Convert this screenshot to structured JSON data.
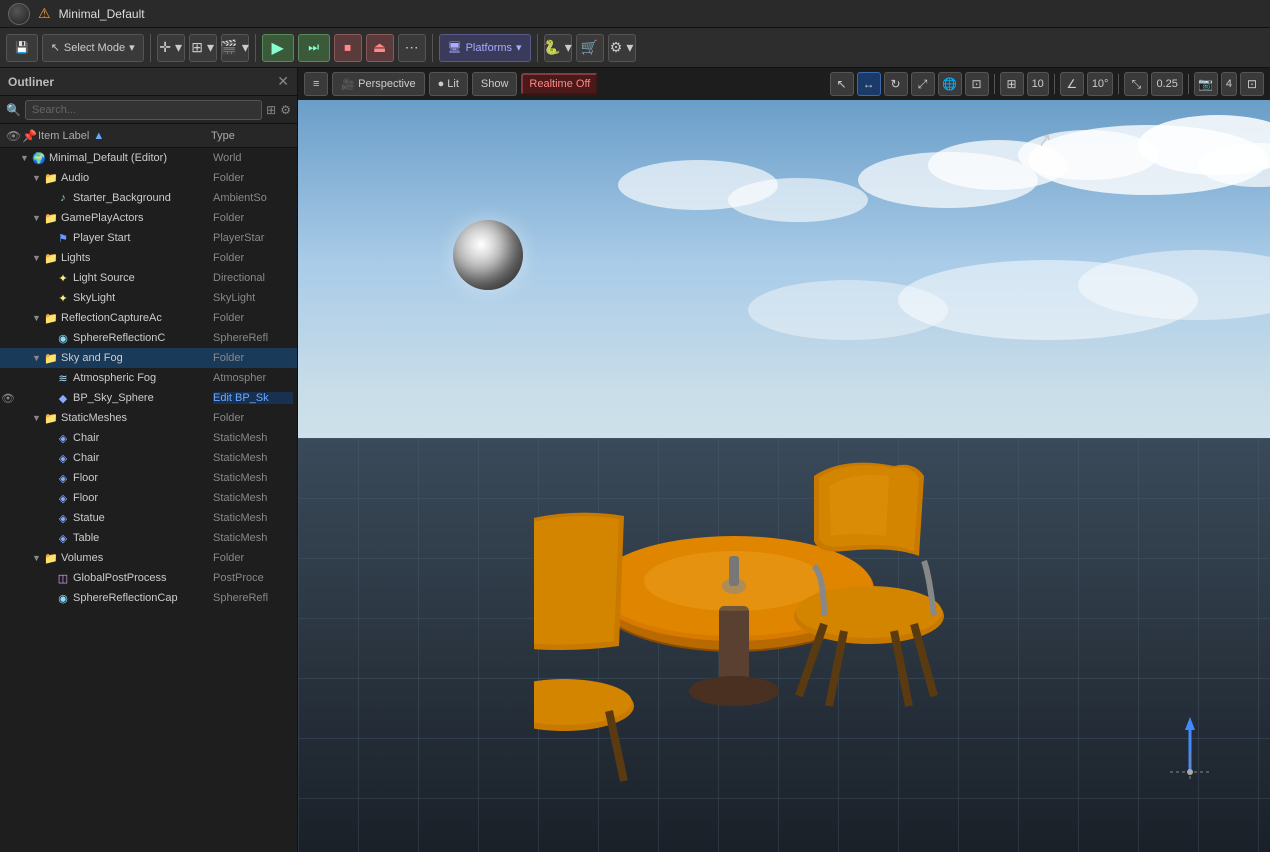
{
  "titleBar": {
    "title": "Minimal_Default",
    "warning": "⚠"
  },
  "toolbar": {
    "selectMode": "Select Mode",
    "platforms": "Platforms",
    "saveLabel": "💾",
    "addLabel": "＋",
    "blueprintLabel": "🔷",
    "cinematicLabel": "🎬",
    "playLabel": "▶",
    "pauseLabel": "⏸",
    "stopLabel": "⏹",
    "ejectLabel": "⏏",
    "moreLabel": "⋯",
    "greenBpLabel": "🐍",
    "settingsLabel": "⚙"
  },
  "outliner": {
    "title": "Outliner",
    "searchPlaceholder": "Search...",
    "colLabel": "Item Label",
    "colType": "Type",
    "items": [
      {
        "label": "Minimal_Default (Editor)",
        "type": "World",
        "indent": 0,
        "expanded": true,
        "icon": "world",
        "eye": false
      },
      {
        "label": "Audio",
        "type": "Folder",
        "indent": 1,
        "expanded": true,
        "icon": "folder",
        "eye": false
      },
      {
        "label": "Starter_Background",
        "type": "AmbientSo",
        "indent": 2,
        "expanded": false,
        "icon": "ambient",
        "eye": false
      },
      {
        "label": "GamePlayActors",
        "type": "Folder",
        "indent": 1,
        "expanded": true,
        "icon": "folder",
        "eye": false
      },
      {
        "label": "Player Start",
        "type": "PlayerStar",
        "indent": 2,
        "expanded": false,
        "icon": "actor",
        "eye": false
      },
      {
        "label": "Lights",
        "type": "Folder",
        "indent": 1,
        "expanded": true,
        "icon": "folder",
        "eye": false
      },
      {
        "label": "Light Source",
        "type": "Directional",
        "indent": 2,
        "expanded": false,
        "icon": "light",
        "eye": false
      },
      {
        "label": "SkyLight",
        "type": "SkyLight",
        "indent": 2,
        "expanded": false,
        "icon": "light",
        "eye": false
      },
      {
        "label": "ReflectionCaptureAc",
        "type": "Folder",
        "indent": 1,
        "expanded": true,
        "icon": "folder",
        "eye": false
      },
      {
        "label": "SphereReflectionC",
        "type": "SphereRefl",
        "indent": 2,
        "expanded": false,
        "icon": "capture",
        "eye": false
      },
      {
        "label": "Sky and Fog",
        "type": "Folder",
        "indent": 1,
        "expanded": true,
        "icon": "folder",
        "eye": false,
        "selected": true
      },
      {
        "label": "Atmospheric Fog",
        "type": "Atmospher",
        "indent": 2,
        "expanded": false,
        "icon": "fog",
        "eye": false
      },
      {
        "label": "BP_Sky_Sphere",
        "type": "Edit BP_Sk",
        "indent": 2,
        "expanded": false,
        "icon": "bp",
        "eye": true,
        "editing": true
      },
      {
        "label": "StaticMeshes",
        "type": "Folder",
        "indent": 1,
        "expanded": true,
        "icon": "folder",
        "eye": false
      },
      {
        "label": "Chair",
        "type": "StaticMesh",
        "indent": 2,
        "expanded": false,
        "icon": "mesh",
        "eye": false
      },
      {
        "label": "Chair",
        "type": "StaticMesh",
        "indent": 2,
        "expanded": false,
        "icon": "mesh",
        "eye": false
      },
      {
        "label": "Floor",
        "type": "StaticMesh",
        "indent": 2,
        "expanded": false,
        "icon": "mesh",
        "eye": false
      },
      {
        "label": "Floor",
        "type": "StaticMesh",
        "indent": 2,
        "expanded": false,
        "icon": "mesh",
        "eye": false
      },
      {
        "label": "Statue",
        "type": "StaticMesh",
        "indent": 2,
        "expanded": false,
        "icon": "mesh",
        "eye": false
      },
      {
        "label": "Table",
        "type": "StaticMesh",
        "indent": 2,
        "expanded": false,
        "icon": "mesh",
        "eye": false
      },
      {
        "label": "Volumes",
        "type": "Folder",
        "indent": 1,
        "expanded": true,
        "icon": "folder",
        "eye": false
      },
      {
        "label": "GlobalPostProcess",
        "type": "PostProce",
        "indent": 2,
        "expanded": false,
        "icon": "post",
        "eye": false
      },
      {
        "label": "SphereReflectionCap",
        "type": "SphereRefl",
        "indent": 2,
        "expanded": false,
        "icon": "capture",
        "eye": false
      }
    ]
  },
  "viewport": {
    "menu": "≡",
    "perspectiveLabel": "Perspective",
    "litLabel": "Lit",
    "showLabel": "Show",
    "realtimeLabel": "Realtime Off",
    "snapAngle": "10°",
    "snapScale": "0.25",
    "snapCount": "4",
    "snapValue": "10"
  }
}
